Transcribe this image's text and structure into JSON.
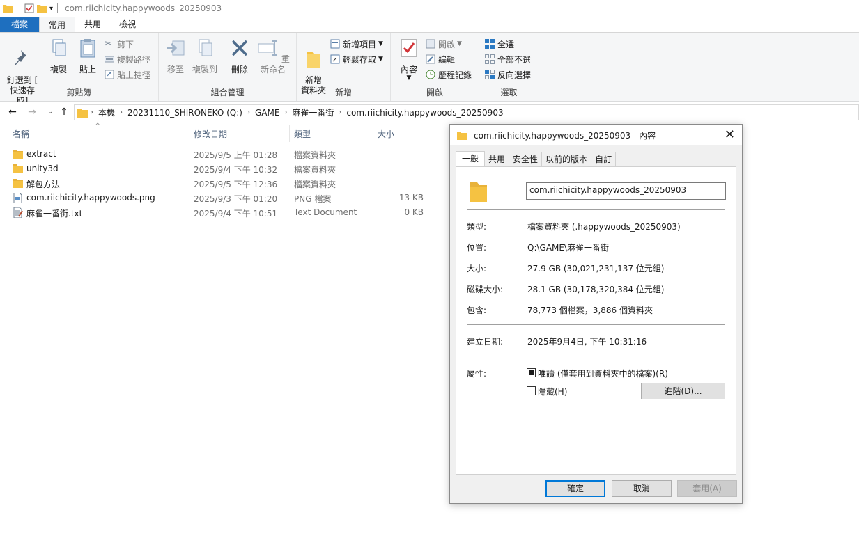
{
  "titlebar": {
    "title": "com.riichicity.happywoods_20250903"
  },
  "tabs": [
    "檔案",
    "常用",
    "共用",
    "檢視"
  ],
  "ribbon": {
    "clipboard": {
      "label": "剪貼簿",
      "pin": "釘選到 [\n快速存取]",
      "copy": "複製",
      "paste": "貼上",
      "cut": "剪下",
      "copy_path": "複製路徑",
      "paste_shortcut": "貼上捷徑"
    },
    "organize": {
      "label": "組合管理",
      "move_to": "移至",
      "copy_to": "複製到",
      "delete": "刪除",
      "rename": "重新命名"
    },
    "new": {
      "label": "新增",
      "new_folder": "新增\n資料夾",
      "new_item": "新增項目",
      "easy_access": "輕鬆存取"
    },
    "open": {
      "label": "開啟",
      "properties": "內容",
      "open": "開啟",
      "edit": "編輯",
      "history": "歷程記錄"
    },
    "select": {
      "label": "選取",
      "select_all": "全選",
      "select_none": "全部不選",
      "invert": "反向選擇"
    }
  },
  "address": {
    "crumbs": [
      "本機",
      "20231110_SHIRONEKO (Q:)",
      "GAME",
      "麻雀一番街",
      "com.riichicity.happywoods_20250903"
    ]
  },
  "list": {
    "headers": {
      "name": "名稱",
      "date": "修改日期",
      "type": "類型",
      "size": "大小"
    },
    "rows": [
      {
        "name": "extract",
        "date": "2025/9/5 上午 01:28",
        "type": "檔案資料夾",
        "size": "",
        "icon": "folder-icon"
      },
      {
        "name": "unity3d",
        "date": "2025/9/4 下午 10:32",
        "type": "檔案資料夾",
        "size": "",
        "icon": "folder-icon"
      },
      {
        "name": "解包方法",
        "date": "2025/9/5 下午 12:36",
        "type": "檔案資料夾",
        "size": "",
        "icon": "folder-icon"
      },
      {
        "name": "com.riichicity.happywoods.png",
        "date": "2025/9/3 下午 01:20",
        "type": "PNG 檔案",
        "size": "13 KB",
        "icon": "image-file-icon"
      },
      {
        "name": "麻雀一番街.txt",
        "date": "2025/9/4 下午 10:51",
        "type": "Text Document",
        "size": "0 KB",
        "icon": "text-file-icon"
      }
    ]
  },
  "dialog": {
    "title": "com.riichicity.happywoods_20250903 - 內容",
    "tabs": [
      "一般",
      "共用",
      "安全性",
      "以前的版本",
      "自訂"
    ],
    "folder_name": "com.riichicity.happywoods_20250903",
    "type_label": "類型:",
    "type_value": "檔案資料夾 (.happywoods_20250903)",
    "location_label": "位置:",
    "location_value": "Q:\\GAME\\麻雀一番街",
    "size_label": "大小:",
    "size_value": "27.9 GB (30,021,231,137 位元組)",
    "disk_size_label": "磁碟大小:",
    "disk_size_value": "28.1 GB (30,178,320,384 位元組)",
    "contains_label": "包含:",
    "contains_value": "78,773 個檔案，3,886 個資料夾",
    "created_label": "建立日期:",
    "created_value": "2025年9月4日, 下午 10:31:16",
    "attributes_label": "屬性:",
    "readonly_label": "唯讀 (僅套用到資料夾中的檔案)(R)",
    "hidden_label": "隱藏(H)",
    "advanced_button": "進階(D)...",
    "ok_button": "確定",
    "cancel_button": "取消",
    "apply_button": "套用(A)"
  },
  "colors": {
    "file_tab": "#1e6fbf",
    "folder": "#f5c242",
    "header_text": "#4c607a",
    "accent": "#0078d7"
  }
}
